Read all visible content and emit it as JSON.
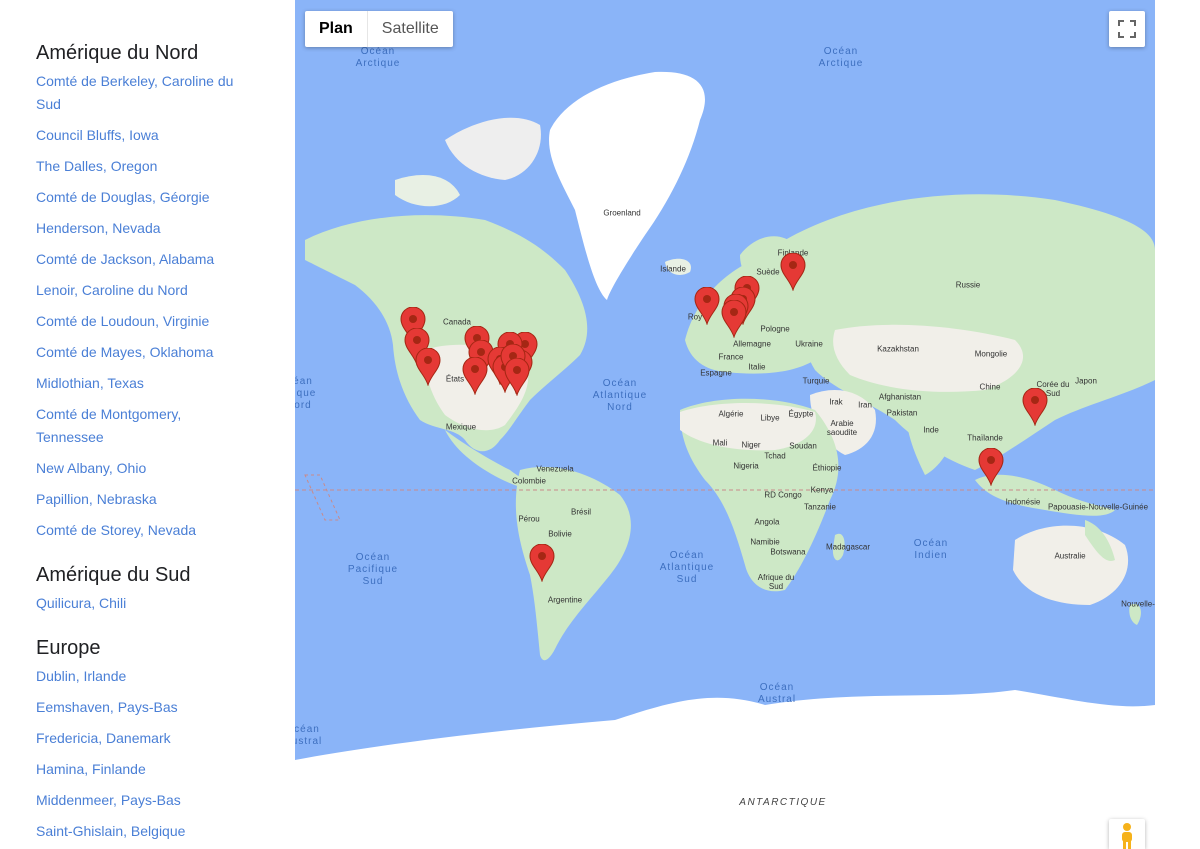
{
  "regions": [
    {
      "title": "Amérique du Nord",
      "locations": [
        "Comté de Berkeley, Caroline du Sud",
        "Council Bluffs, Iowa",
        "The Dalles, Oregon",
        "Comté de Douglas, Géorgie",
        "Henderson, Nevada",
        "Comté de Jackson, Alabama",
        "Lenoir, Caroline du Nord",
        "Comté de Loudoun, Virginie",
        "Comté de Mayes, Oklahoma",
        "Midlothian, Texas",
        "Comté de Montgomery, Tennessee",
        "New Albany, Ohio",
        "Papillion, Nebraska",
        "Comté de Storey, Nevada"
      ]
    },
    {
      "title": "Amérique du Sud",
      "locations": [
        "Quilicura, Chili"
      ]
    },
    {
      "title": "Europe",
      "locations": [
        "Dublin, Irlande",
        "Eemshaven, Pays-Bas",
        "Fredericia, Danemark",
        "Hamina, Finlande",
        "Middenmeer, Pays-Bas",
        "Saint-Ghislain, Belgique"
      ]
    }
  ],
  "map": {
    "type_buttons": [
      "Plan",
      "Satellite"
    ],
    "active_type": "Plan",
    "fullscreen_icon": "fullscreen-icon",
    "pegman_icon": "pegman-icon",
    "colors": {
      "water": "#8ab4f8",
      "land": "#f1efe9",
      "green": "#bfe3bf",
      "ice": "#ffffff",
      "marker": "#e53935",
      "marker_dark": "#a52714"
    },
    "labels": [
      {
        "text": "Groenland"
      },
      {
        "text": "Islande"
      },
      {
        "text": "Canada"
      },
      {
        "text": "États"
      },
      {
        "text": "Mexique"
      },
      {
        "text": "Venezuela"
      },
      {
        "text": "Colombie"
      },
      {
        "text": "Pérou"
      },
      {
        "text": "Brésil"
      },
      {
        "text": "Bolivie"
      },
      {
        "text": "Argentine"
      },
      {
        "text": "Finlande"
      },
      {
        "text": "Suède"
      },
      {
        "text": "Roy"
      },
      {
        "text": "Pologne"
      },
      {
        "text": "Allemagne"
      },
      {
        "text": "Ukraine"
      },
      {
        "text": "France"
      },
      {
        "text": "Espagne"
      },
      {
        "text": "Italie"
      },
      {
        "text": "Turquie"
      },
      {
        "text": "Russie"
      },
      {
        "text": "Kazakhstan"
      },
      {
        "text": "Mongolie"
      },
      {
        "text": "Chine"
      },
      {
        "text": "Corée du Sud"
      },
      {
        "text": "Japon"
      },
      {
        "text": "Irak"
      },
      {
        "text": "Iran"
      },
      {
        "text": "Afghanistan"
      },
      {
        "text": "Pakistan"
      },
      {
        "text": "Algérie"
      },
      {
        "text": "Libye"
      },
      {
        "text": "Égypte"
      },
      {
        "text": "Arabie saoudite"
      },
      {
        "text": "Inde"
      },
      {
        "text": "Thaïlande"
      },
      {
        "text": "Mali"
      },
      {
        "text": "Niger"
      },
      {
        "text": "Tchad"
      },
      {
        "text": "Soudan"
      },
      {
        "text": "Nigeria"
      },
      {
        "text": "Éthiopie"
      },
      {
        "text": "RD Congo"
      },
      {
        "text": "Kenya"
      },
      {
        "text": "Tanzanie"
      },
      {
        "text": "Angola"
      },
      {
        "text": "Namibie"
      },
      {
        "text": "Botswana"
      },
      {
        "text": "Madagascar"
      },
      {
        "text": "Afrique du Sud"
      },
      {
        "text": "Indonésie"
      },
      {
        "text": "Papouasie-Nouvelle-Guinée"
      },
      {
        "text": "Australie"
      },
      {
        "text": "Nouvelle-"
      }
    ],
    "oceans": [
      "Océan Arctique",
      "Océan Arctique",
      "éan fique ord",
      "Océan Atlantique Nord",
      "Océan Pacifique Sud",
      "Océan Atlantique Sud",
      "Océan Indien",
      "Océan Austral",
      "céan ustral"
    ],
    "antarctica": "ANTARCTIQUE",
    "markers": [
      {
        "name": "The Dalles"
      },
      {
        "name": "Storey"
      },
      {
        "name": "Henderson"
      },
      {
        "name": "Council Bluffs"
      },
      {
        "name": "Papillion"
      },
      {
        "name": "Mayes"
      },
      {
        "name": "Midlothian"
      },
      {
        "name": "New Albany"
      },
      {
        "name": "Loudoun"
      },
      {
        "name": "Montgomery"
      },
      {
        "name": "Jackson"
      },
      {
        "name": "Douglas"
      },
      {
        "name": "Lenoir"
      },
      {
        "name": "Berkeley"
      },
      {
        "name": "Quilicura"
      },
      {
        "name": "Dublin"
      },
      {
        "name": "Fredericia"
      },
      {
        "name": "Eemshaven"
      },
      {
        "name": "Middenmeer"
      },
      {
        "name": "Saint-Ghislain"
      },
      {
        "name": "Hamina"
      },
      {
        "name": "Changhua"
      },
      {
        "name": "Singapour"
      }
    ]
  }
}
